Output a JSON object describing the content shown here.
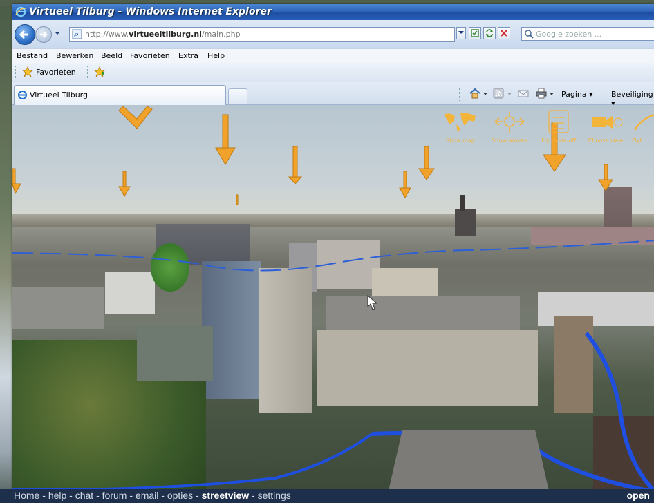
{
  "browser": {
    "window_title": "Virtueel Tilburg - Windows Internet Explorer",
    "address_prefix": "http://www.",
    "address_domain": "virtueeltilburg.nl",
    "address_path": "/main.php",
    "search_placeholder": "Google zoeken ...",
    "menu": [
      "Bestand",
      "Bewerken",
      "Beeld",
      "Favorieten",
      "Extra",
      "Help"
    ],
    "favorites_label": "Favorieten",
    "tab_label": "Virtueel Tilburg",
    "command_bar": {
      "page": "Pagina",
      "security": "Beveiliging"
    }
  },
  "viewer": {
    "hud_buttons": [
      {
        "label": "Show map",
        "icon": "world-map-icon"
      },
      {
        "label": "Show arrows",
        "icon": "arrows-icon"
      },
      {
        "label": "Fly mode off",
        "icon": "fly-mode-icon"
      },
      {
        "label": "Choose view",
        "icon": "camera-icon"
      },
      {
        "label": "Flyt",
        "icon": "fly-icon"
      }
    ]
  },
  "site_nav": {
    "links": [
      "Home",
      "help",
      "chat",
      "forum",
      "email",
      "opties",
      "streetview",
      "settings"
    ],
    "selected": "streetview",
    "right_label": "open"
  },
  "colors": {
    "accent_orange": "#f0a22a",
    "bottom_bar": "#1d2f4a",
    "title_bar": "#2e63b8"
  }
}
